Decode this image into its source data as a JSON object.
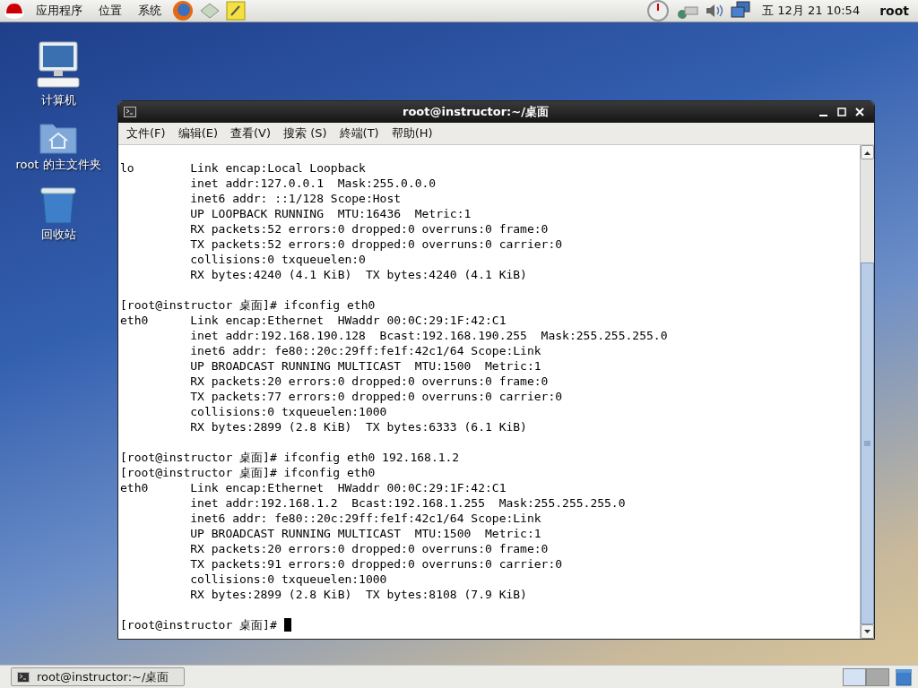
{
  "top_panel": {
    "menus": [
      "应用程序",
      "位置",
      "系统"
    ],
    "clock": "五 12月 21 10:54",
    "user": "root"
  },
  "desktop_icons": [
    {
      "kind": "computer",
      "label": "计算机"
    },
    {
      "kind": "home",
      "label": "root 的主文件夹"
    },
    {
      "kind": "trash",
      "label": "回收站"
    }
  ],
  "terminal": {
    "title": "root@instructor:~/桌面",
    "menus": [
      "文件(F)",
      "编辑(E)",
      "查看(V)",
      "搜索 (S)",
      "終端(T)",
      "帮助(H)"
    ],
    "blocks": [
      [
        "lo        Link encap:Local Loopback",
        "          inet addr:127.0.0.1  Mask:255.0.0.0",
        "          inet6 addr: ::1/128 Scope:Host",
        "          UP LOOPBACK RUNNING  MTU:16436  Metric:1",
        "          RX packets:52 errors:0 dropped:0 overruns:0 frame:0",
        "          TX packets:52 errors:0 dropped:0 overruns:0 carrier:0",
        "          collisions:0 txqueuelen:0",
        "          RX bytes:4240 (4.1 KiB)  TX bytes:4240 (4.1 KiB)"
      ],
      [
        "[root@instructor 桌面]# ifconfig eth0",
        "eth0      Link encap:Ethernet  HWaddr 00:0C:29:1F:42:C1",
        "          inet addr:192.168.190.128  Bcast:192.168.190.255  Mask:255.255.255.0",
        "          inet6 addr: fe80::20c:29ff:fe1f:42c1/64 Scope:Link",
        "          UP BROADCAST RUNNING MULTICAST  MTU:1500  Metric:1",
        "          RX packets:20 errors:0 dropped:0 overruns:0 frame:0",
        "          TX packets:77 errors:0 dropped:0 overruns:0 carrier:0",
        "          collisions:0 txqueuelen:1000",
        "          RX bytes:2899 (2.8 KiB)  TX bytes:6333 (6.1 KiB)"
      ],
      [
        "[root@instructor 桌面]# ifconfig eth0 192.168.1.2",
        "[root@instructor 桌面]# ifconfig eth0",
        "eth0      Link encap:Ethernet  HWaddr 00:0C:29:1F:42:C1",
        "          inet addr:192.168.1.2  Bcast:192.168.1.255  Mask:255.255.255.0",
        "          inet6 addr: fe80::20c:29ff:fe1f:42c1/64 Scope:Link",
        "          UP BROADCAST RUNNING MULTICAST  MTU:1500  Metric:1",
        "          RX packets:20 errors:0 dropped:0 overruns:0 frame:0",
        "          TX packets:91 errors:0 dropped:0 overruns:0 carrier:0",
        "          collisions:0 txqueuelen:1000",
        "          RX bytes:2899 (2.8 KiB)  TX bytes:8108 (7.9 KiB)"
      ],
      [
        "[root@instructor 桌面]# "
      ]
    ],
    "cursor": true
  },
  "taskbar": {
    "tasks": [
      {
        "label": "root@instructor:~/桌面",
        "selected": false
      }
    ],
    "workspaces": [
      {
        "selected": true
      },
      {
        "selected": false
      }
    ]
  }
}
